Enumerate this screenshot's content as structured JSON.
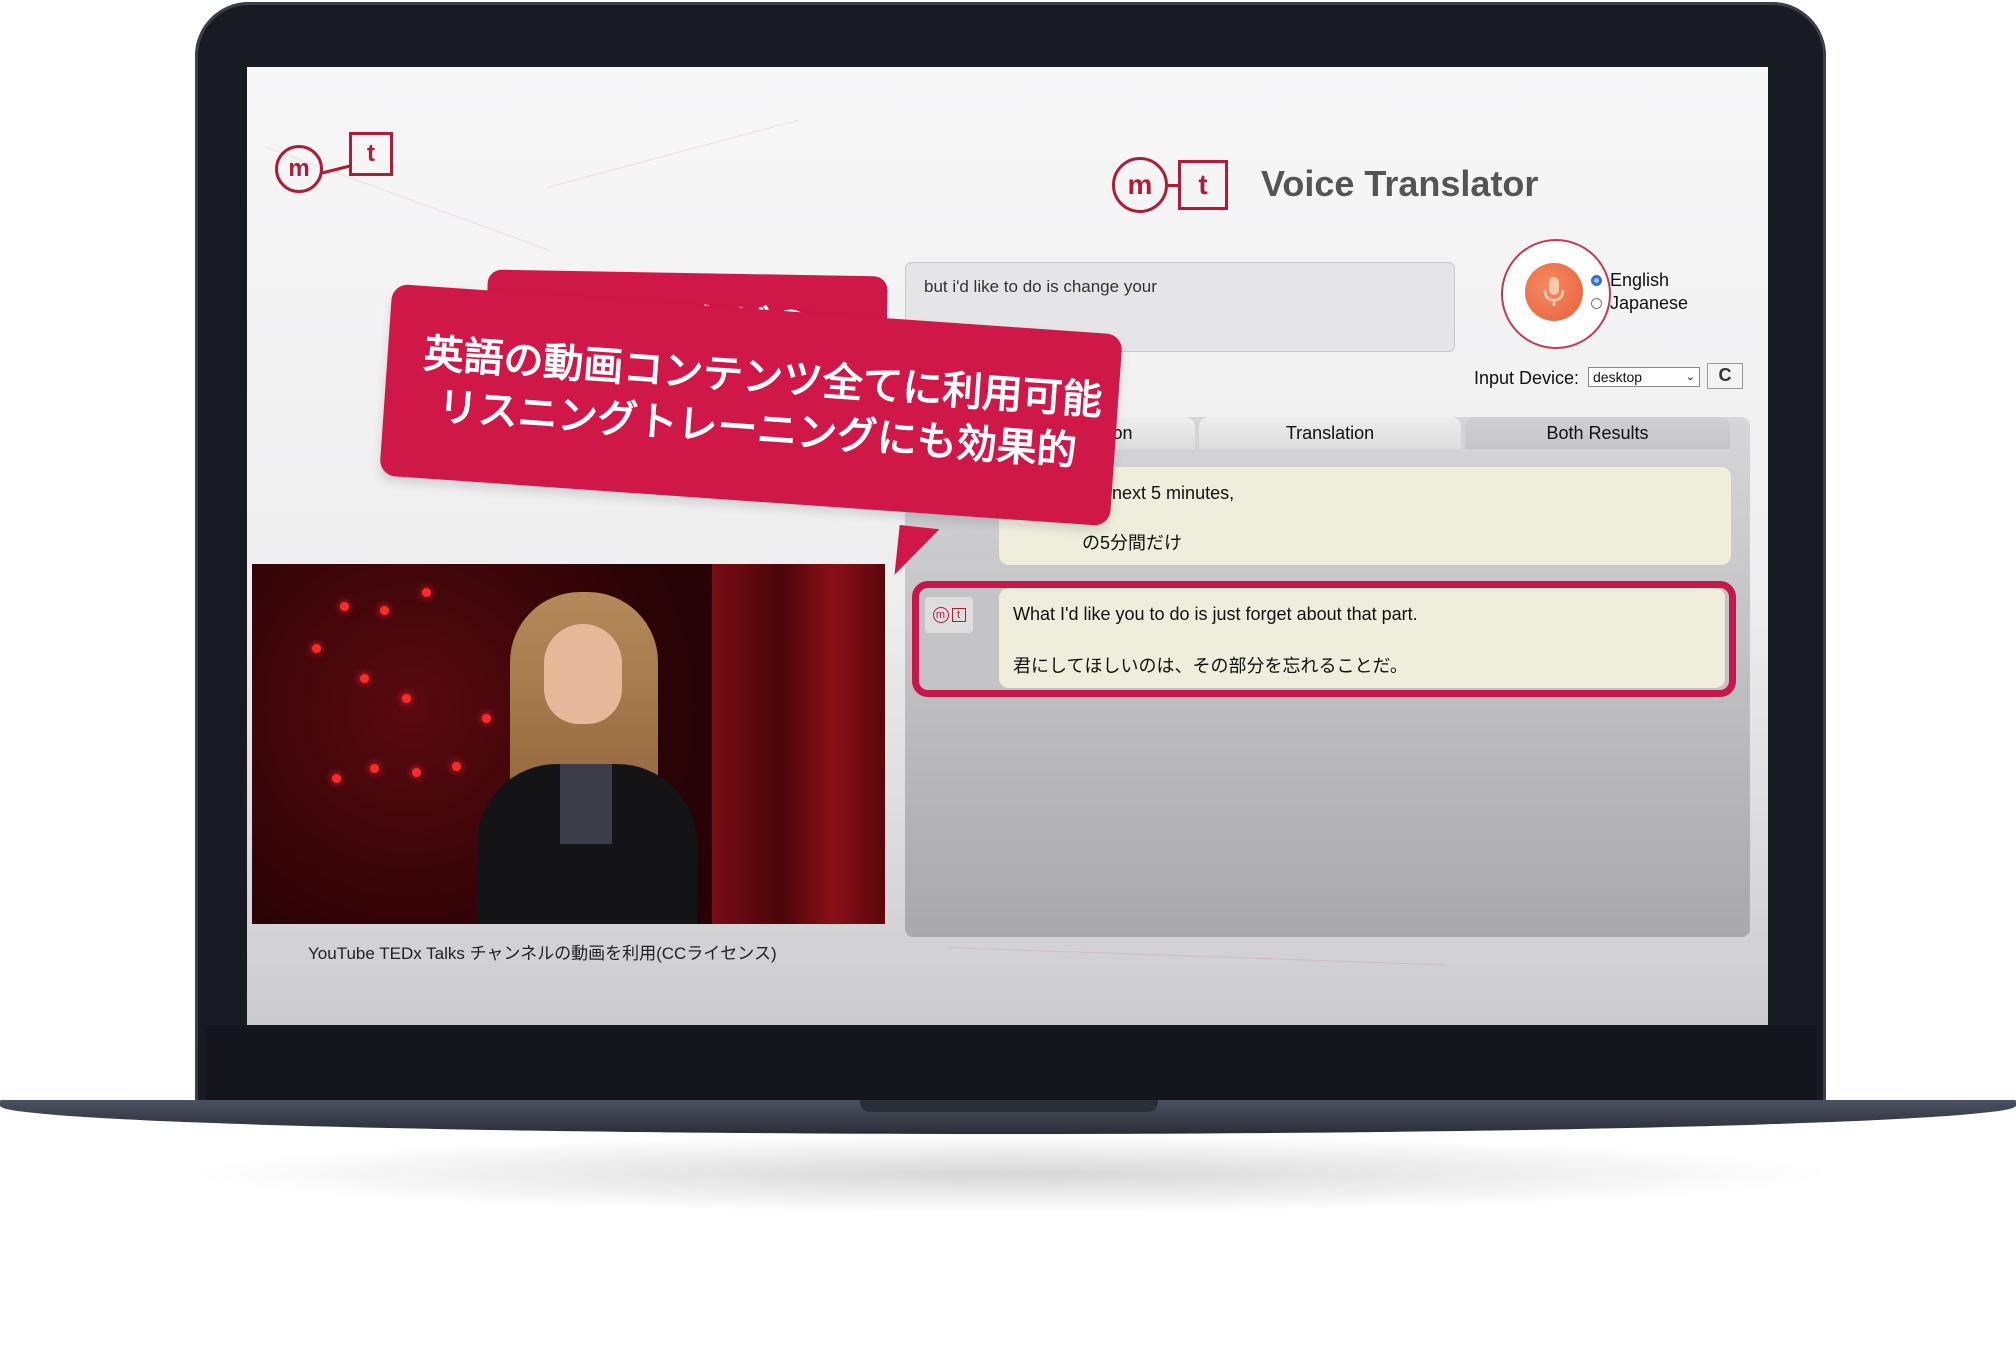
{
  "app": {
    "title": "Voice Translator",
    "logo_m": "m",
    "logo_t": "t"
  },
  "input": {
    "text": "but i'd like to do is change your"
  },
  "language": {
    "options": [
      "English",
      "Japanese"
    ],
    "selected": "English"
  },
  "device": {
    "label": "Input Device:",
    "selected": "desktop",
    "refresh_glyph": "C"
  },
  "tabs": [
    {
      "label": "ition"
    },
    {
      "label": "Translation"
    },
    {
      "label": "Both Results"
    }
  ],
  "results": [
    {
      "english": "the next 5 minutes,",
      "japanese": "の5分間だけ"
    },
    {
      "english": "What I'd like you to do is just forget about that part.",
      "japanese": "君にしてほしいのは、その部分を忘れることだ。"
    }
  ],
  "promo": {
    "line1": "YouTubeなどの",
    "line2": "英語の動画コンテンツ全てに利用可能",
    "line3": "リスニングトレーニングにも効果的"
  },
  "video": {
    "caption": "YouTube TEDx Talks チャンネルの動画を利用(CCライセンス)"
  },
  "colors": {
    "brand": "#b01c36",
    "promo": "#cf1847",
    "mic": "#e7603b",
    "highlight": "#c8174a"
  }
}
